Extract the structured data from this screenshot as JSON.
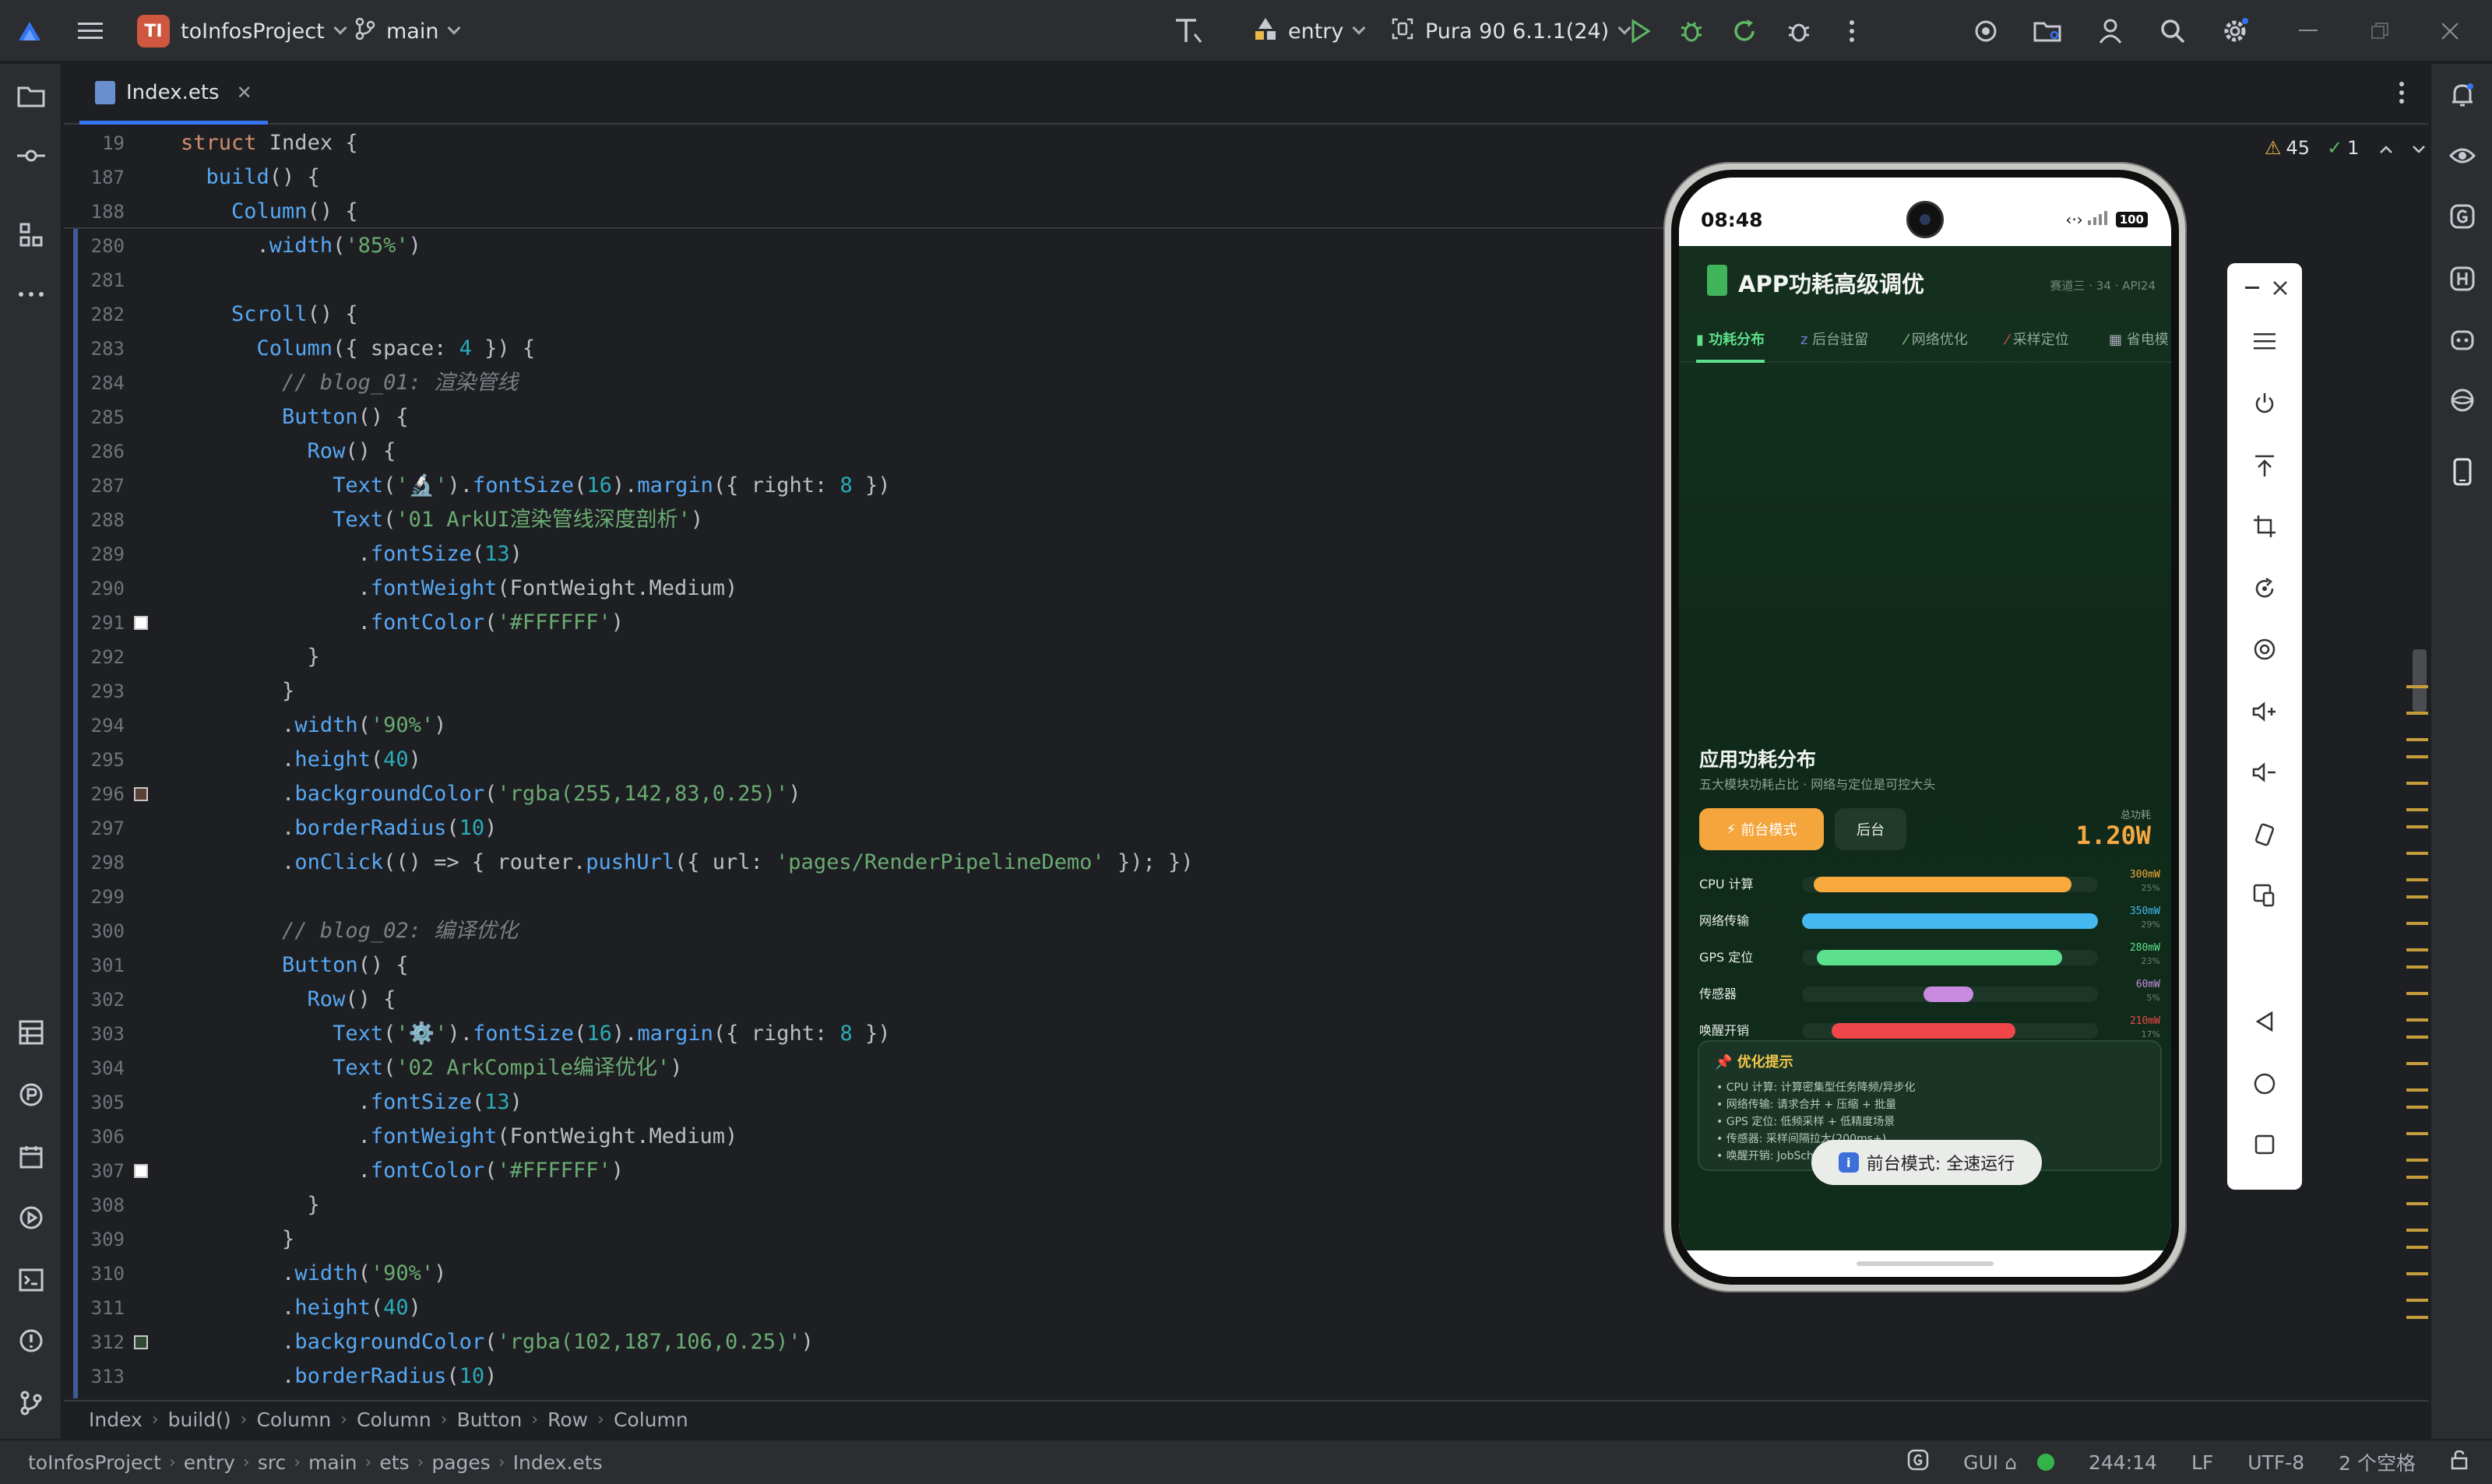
{
  "titlebar": {
    "project_badge": "TI",
    "project_name": "toInfosProject",
    "branch": "main",
    "run_config": "entry",
    "device": "Pura 90 6.1.1(24)"
  },
  "editor": {
    "tab_name": "Index.ets",
    "inspection": {
      "warnings": "45",
      "ok": "1"
    },
    "sticky": [
      {
        "ln": "19",
        "code": [
          [
            "kw",
            "struct "
          ],
          [
            "plain",
            "Index {"
          ]
        ]
      },
      {
        "ln": "187",
        "code": [
          [
            "fn",
            "  build"
          ],
          [
            "plain",
            "() {"
          ]
        ]
      },
      {
        "ln": "188",
        "code": [
          [
            "fn",
            "    Column"
          ],
          [
            "plain",
            "() {"
          ]
        ]
      }
    ],
    "lines": [
      {
        "ln": "280",
        "code": [
          [
            "plain",
            "      ."
          ],
          [
            "fn",
            "width"
          ],
          [
            "plain",
            "("
          ],
          [
            "str",
            "'85%'"
          ],
          [
            "plain",
            ")"
          ]
        ]
      },
      {
        "ln": "281",
        "code": []
      },
      {
        "ln": "282",
        "code": [
          [
            "fn",
            "    Scroll"
          ],
          [
            "plain",
            "() {"
          ]
        ]
      },
      {
        "ln": "283",
        "code": [
          [
            "fn",
            "      Column"
          ],
          [
            "plain",
            "({ space: "
          ],
          [
            "num",
            "4"
          ],
          [
            "plain",
            " }) {"
          ]
        ]
      },
      {
        "ln": "284",
        "code": [
          [
            "cmt",
            "        // blog_01: 渲染管线"
          ]
        ]
      },
      {
        "ln": "285",
        "code": [
          [
            "fn",
            "        Button"
          ],
          [
            "plain",
            "() {"
          ]
        ]
      },
      {
        "ln": "286",
        "code": [
          [
            "fn",
            "          Row"
          ],
          [
            "plain",
            "() {"
          ]
        ]
      },
      {
        "ln": "287",
        "code": [
          [
            "fn",
            "            Text"
          ],
          [
            "plain",
            "("
          ],
          [
            "str",
            "'🔬'"
          ],
          [
            "plain",
            ")."
          ],
          [
            "fn",
            "fontSize"
          ],
          [
            "plain",
            "("
          ],
          [
            "num",
            "16"
          ],
          [
            "plain",
            ")."
          ],
          [
            "fn",
            "margin"
          ],
          [
            "plain",
            "({ right: "
          ],
          [
            "num",
            "8"
          ],
          [
            "plain",
            " })"
          ]
        ]
      },
      {
        "ln": "288",
        "code": [
          [
            "fn",
            "            Text"
          ],
          [
            "plain",
            "("
          ],
          [
            "str",
            "'01 ArkUI渲染管线深度剖析'"
          ],
          [
            "plain",
            ")"
          ]
        ]
      },
      {
        "ln": "289",
        "code": [
          [
            "plain",
            "              ."
          ],
          [
            "fn",
            "fontSize"
          ],
          [
            "plain",
            "("
          ],
          [
            "num",
            "13"
          ],
          [
            "plain",
            ")"
          ]
        ]
      },
      {
        "ln": "290",
        "code": [
          [
            "plain",
            "              ."
          ],
          [
            "fn",
            "fontWeight"
          ],
          [
            "plain",
            "(FontWeight.Medium)"
          ]
        ]
      },
      {
        "ln": "291",
        "code": [
          [
            "plain",
            "              ."
          ],
          [
            "fn",
            "fontColor"
          ],
          [
            "plain",
            "("
          ],
          [
            "str",
            "'#FFFFFF'"
          ],
          [
            "plain",
            ")"
          ]
        ],
        "marker": "#ffffff"
      },
      {
        "ln": "292",
        "code": [
          [
            "plain",
            "          }"
          ]
        ]
      },
      {
        "ln": "293",
        "code": [
          [
            "plain",
            "        }"
          ]
        ]
      },
      {
        "ln": "294",
        "code": [
          [
            "plain",
            "        ."
          ],
          [
            "fn",
            "width"
          ],
          [
            "plain",
            "("
          ],
          [
            "str",
            "'90%'"
          ],
          [
            "plain",
            ")"
          ]
        ]
      },
      {
        "ln": "295",
        "code": [
          [
            "plain",
            "        ."
          ],
          [
            "fn",
            "height"
          ],
          [
            "plain",
            "("
          ],
          [
            "num",
            "40"
          ],
          [
            "plain",
            ")"
          ]
        ]
      },
      {
        "ln": "296",
        "code": [
          [
            "plain",
            "        ."
          ],
          [
            "fn",
            "backgroundColor"
          ],
          [
            "plain",
            "("
          ],
          [
            "str",
            "'rgba(255,142,83,0.25)'"
          ],
          [
            "plain",
            ")"
          ]
        ],
        "marker": "#5a3f33"
      },
      {
        "ln": "297",
        "code": [
          [
            "plain",
            "        ."
          ],
          [
            "fn",
            "borderRadius"
          ],
          [
            "plain",
            "("
          ],
          [
            "num",
            "10"
          ],
          [
            "plain",
            ")"
          ]
        ]
      },
      {
        "ln": "298",
        "code": [
          [
            "plain",
            "        ."
          ],
          [
            "fn",
            "onClick"
          ],
          [
            "plain",
            "(() => { router."
          ],
          [
            "fn",
            "pushUrl"
          ],
          [
            "plain",
            "({ url: "
          ],
          [
            "str",
            "'pages/RenderPipelineDemo'"
          ],
          [
            "plain",
            " }); })"
          ]
        ]
      },
      {
        "ln": "299",
        "code": []
      },
      {
        "ln": "300",
        "code": [
          [
            "cmt",
            "        // blog_02: 编译优化"
          ]
        ]
      },
      {
        "ln": "301",
        "code": [
          [
            "fn",
            "        Button"
          ],
          [
            "plain",
            "() {"
          ]
        ]
      },
      {
        "ln": "302",
        "code": [
          [
            "fn",
            "          Row"
          ],
          [
            "plain",
            "() {"
          ]
        ]
      },
      {
        "ln": "303",
        "code": [
          [
            "fn",
            "            Text"
          ],
          [
            "plain",
            "("
          ],
          [
            "str",
            "'⚙️'"
          ],
          [
            "plain",
            ")."
          ],
          [
            "fn",
            "fontSize"
          ],
          [
            "plain",
            "("
          ],
          [
            "num",
            "16"
          ],
          [
            "plain",
            ")."
          ],
          [
            "fn",
            "margin"
          ],
          [
            "plain",
            "({ right: "
          ],
          [
            "num",
            "8"
          ],
          [
            "plain",
            " })"
          ]
        ]
      },
      {
        "ln": "304",
        "code": [
          [
            "fn",
            "            Text"
          ],
          [
            "plain",
            "("
          ],
          [
            "str",
            "'02 ArkCompile编译优化'"
          ],
          [
            "plain",
            ")"
          ]
        ]
      },
      {
        "ln": "305",
        "code": [
          [
            "plain",
            "              ."
          ],
          [
            "fn",
            "fontSize"
          ],
          [
            "plain",
            "("
          ],
          [
            "num",
            "13"
          ],
          [
            "plain",
            ")"
          ]
        ]
      },
      {
        "ln": "306",
        "code": [
          [
            "plain",
            "              ."
          ],
          [
            "fn",
            "fontWeight"
          ],
          [
            "plain",
            "(FontWeight.Medium)"
          ]
        ]
      },
      {
        "ln": "307",
        "code": [
          [
            "plain",
            "              ."
          ],
          [
            "fn",
            "fontColor"
          ],
          [
            "plain",
            "("
          ],
          [
            "str",
            "'#FFFFFF'"
          ],
          [
            "plain",
            ")"
          ]
        ],
        "marker": "#ffffff"
      },
      {
        "ln": "308",
        "code": [
          [
            "plain",
            "          }"
          ]
        ]
      },
      {
        "ln": "309",
        "code": [
          [
            "plain",
            "        }"
          ]
        ]
      },
      {
        "ln": "310",
        "code": [
          [
            "plain",
            "        ."
          ],
          [
            "fn",
            "width"
          ],
          [
            "plain",
            "("
          ],
          [
            "str",
            "'90%'"
          ],
          [
            "plain",
            ")"
          ]
        ]
      },
      {
        "ln": "311",
        "code": [
          [
            "plain",
            "        ."
          ],
          [
            "fn",
            "height"
          ],
          [
            "plain",
            "("
          ],
          [
            "num",
            "40"
          ],
          [
            "plain",
            ")"
          ]
        ]
      },
      {
        "ln": "312",
        "code": [
          [
            "plain",
            "        ."
          ],
          [
            "fn",
            "backgroundColor"
          ],
          [
            "plain",
            "("
          ],
          [
            "str",
            "'rgba(102,187,106,0.25)'"
          ],
          [
            "plain",
            ")"
          ]
        ],
        "marker": "#2f4a33"
      },
      {
        "ln": "313",
        "code": [
          [
            "plain",
            "        ."
          ],
          [
            "fn",
            "borderRadius"
          ],
          [
            "plain",
            "("
          ],
          [
            "num",
            "10"
          ],
          [
            "plain",
            ")"
          ]
        ]
      }
    ]
  },
  "breadcrumb": [
    "Index",
    "build()",
    "Column",
    "Column",
    "Button",
    "Row",
    "Column"
  ],
  "statusbar": {
    "path": [
      "toInfosProject",
      "entry",
      "src",
      "main",
      "ets",
      "pages",
      "Index.ets"
    ],
    "gui": "GUI",
    "position": "244:14",
    "line_sep": "LF",
    "encoding": "UTF-8",
    "indent": "2 个空格"
  },
  "phone": {
    "time": "08:48",
    "battery": "100",
    "app_title": "APP功耗高级调优",
    "app_meta": "赛道三 · 34 · API24",
    "tabs": [
      "功耗分布",
      "后台驻留",
      "网络优化",
      "采样定位",
      "省电模"
    ],
    "section_title": "应用功耗分布",
    "section_sub": "五大模块功耗占比 · 网络与定位是可控大头",
    "mode_fg": "前台模式",
    "mode_bg": "后台",
    "total_label": "总功耗",
    "total_value": "1.20W",
    "bars": [
      {
        "label": "CPU 计算",
        "value": "300mW",
        "pct": "25%",
        "color": "#f7a93c",
        "start": 0.04,
        "end": 0.91
      },
      {
        "label": "网络传输",
        "value": "350mW",
        "pct": "29%",
        "color": "#45b8f0",
        "start": 0.0,
        "end": 1.0
      },
      {
        "label": "GPS 定位",
        "value": "280mW",
        "pct": "23%",
        "color": "#5ce08e",
        "start": 0.05,
        "end": 0.88
      },
      {
        "label": "传感器",
        "value": "60mW",
        "pct": "5%",
        "color": "#c88be0",
        "start": 0.41,
        "end": 0.58
      },
      {
        "label": "唤醒开销",
        "value": "210mW",
        "pct": "17%",
        "color": "#f0464a",
        "start": 0.1,
        "end": 0.72
      }
    ],
    "tips_title": "优化提示",
    "tips": [
      "CPU 计算: 计算密集型任务降频/异步化",
      "网络传输: 请求合并 + 压缩 + 批量",
      "GPS 定位: 低频采样 + 低精度场景",
      "传感器: 采样间隔拉大(200ms+)",
      "唤醒开销: JobScheduler 合并唤醒"
    ],
    "toast": "前台模式: 全速运行"
  }
}
